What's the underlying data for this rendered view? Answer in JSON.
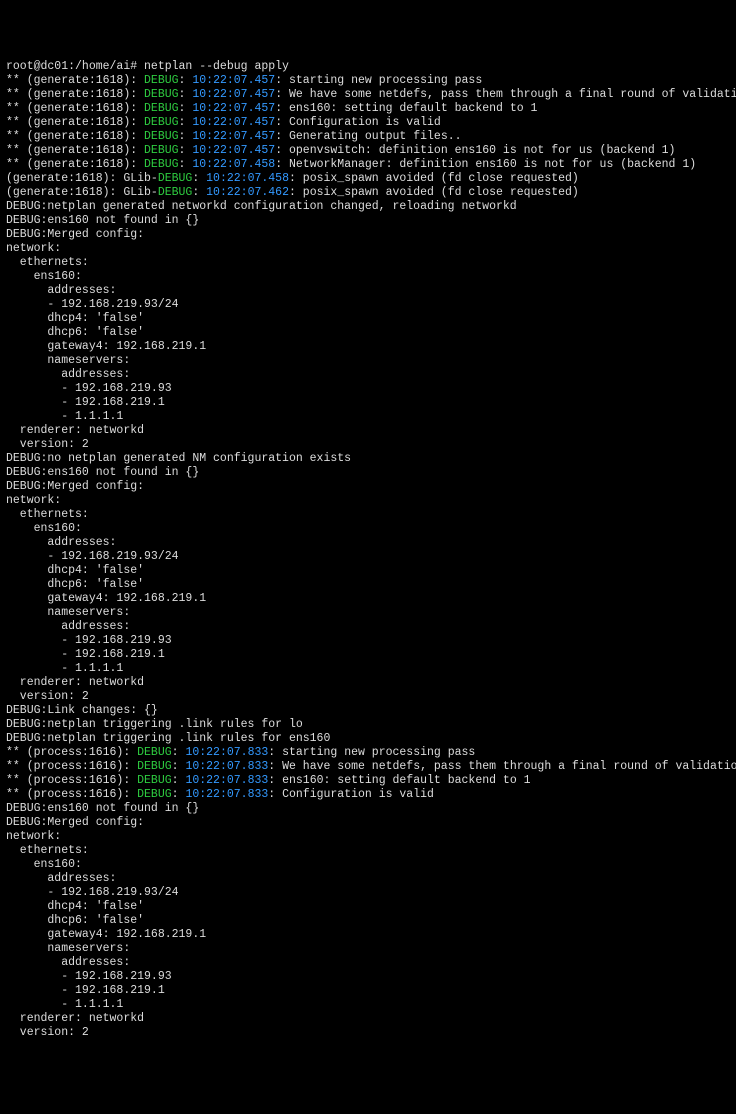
{
  "prompt": "root@dc01:/home/ai# netplan --debug apply",
  "lines": [
    {
      "segs": [
        {
          "t": "** (generate:1618): ",
          "c": "w"
        },
        {
          "t": "DEBUG",
          "c": "g"
        },
        {
          "t": ": ",
          "c": "w"
        },
        {
          "t": "10:22:07.457",
          "c": "b"
        },
        {
          "t": ": starting new processing pass",
          "c": "w"
        }
      ]
    },
    {
      "segs": [
        {
          "t": "** (generate:1618): ",
          "c": "w"
        },
        {
          "t": "DEBUG",
          "c": "g"
        },
        {
          "t": ": ",
          "c": "w"
        },
        {
          "t": "10:22:07.457",
          "c": "b"
        },
        {
          "t": ": We have some netdefs, pass them through a final round of validation",
          "c": "w"
        }
      ]
    },
    {
      "segs": [
        {
          "t": "** (generate:1618): ",
          "c": "w"
        },
        {
          "t": "DEBUG",
          "c": "g"
        },
        {
          "t": ": ",
          "c": "w"
        },
        {
          "t": "10:22:07.457",
          "c": "b"
        },
        {
          "t": ": ens160: setting default backend to 1",
          "c": "w"
        }
      ]
    },
    {
      "segs": [
        {
          "t": "** (generate:1618): ",
          "c": "w"
        },
        {
          "t": "DEBUG",
          "c": "g"
        },
        {
          "t": ": ",
          "c": "w"
        },
        {
          "t": "10:22:07.457",
          "c": "b"
        },
        {
          "t": ": Configuration is valid",
          "c": "w"
        }
      ]
    },
    {
      "segs": [
        {
          "t": "** (generate:1618): ",
          "c": "w"
        },
        {
          "t": "DEBUG",
          "c": "g"
        },
        {
          "t": ": ",
          "c": "w"
        },
        {
          "t": "10:22:07.457",
          "c": "b"
        },
        {
          "t": ": Generating output files..",
          "c": "w"
        }
      ]
    },
    {
      "segs": [
        {
          "t": "** (generate:1618): ",
          "c": "w"
        },
        {
          "t": "DEBUG",
          "c": "g"
        },
        {
          "t": ": ",
          "c": "w"
        },
        {
          "t": "10:22:07.457",
          "c": "b"
        },
        {
          "t": ": openvswitch: definition ens160 is not for us (backend 1)",
          "c": "w"
        }
      ]
    },
    {
      "segs": [
        {
          "t": "** (generate:1618): ",
          "c": "w"
        },
        {
          "t": "DEBUG",
          "c": "g"
        },
        {
          "t": ": ",
          "c": "w"
        },
        {
          "t": "10:22:07.458",
          "c": "b"
        },
        {
          "t": ": NetworkManager: definition ens160 is not for us (backend 1)",
          "c": "w"
        }
      ]
    },
    {
      "segs": [
        {
          "t": "(generate:1618): GLib-",
          "c": "w"
        },
        {
          "t": "DEBUG",
          "c": "g"
        },
        {
          "t": ": ",
          "c": "w"
        },
        {
          "t": "10:22:07.458",
          "c": "b"
        },
        {
          "t": ": posix_spawn avoided (fd close requested)",
          "c": "w"
        }
      ]
    },
    {
      "segs": [
        {
          "t": "(generate:1618): GLib-",
          "c": "w"
        },
        {
          "t": "DEBUG",
          "c": "g"
        },
        {
          "t": ": ",
          "c": "w"
        },
        {
          "t": "10:22:07.462",
          "c": "b"
        },
        {
          "t": ": posix_spawn avoided (fd close requested)",
          "c": "w"
        }
      ]
    },
    {
      "segs": [
        {
          "t": "DEBUG:netplan generated networkd configuration changed, reloading networkd",
          "c": "w"
        }
      ]
    },
    {
      "segs": [
        {
          "t": "DEBUG:ens160 not found in {}",
          "c": "w"
        }
      ]
    },
    {
      "segs": [
        {
          "t": "DEBUG:Merged config:",
          "c": "w"
        }
      ]
    },
    {
      "segs": [
        {
          "t": "network:",
          "c": "w"
        }
      ]
    },
    {
      "segs": [
        {
          "t": "  ethernets:",
          "c": "w"
        }
      ]
    },
    {
      "segs": [
        {
          "t": "    ens160:",
          "c": "w"
        }
      ]
    },
    {
      "segs": [
        {
          "t": "      addresses:",
          "c": "w"
        }
      ]
    },
    {
      "segs": [
        {
          "t": "      - 192.168.219.93/24",
          "c": "w"
        }
      ]
    },
    {
      "segs": [
        {
          "t": "      dhcp4: 'false'",
          "c": "w"
        }
      ]
    },
    {
      "segs": [
        {
          "t": "      dhcp6: 'false'",
          "c": "w"
        }
      ]
    },
    {
      "segs": [
        {
          "t": "      gateway4: 192.168.219.1",
          "c": "w"
        }
      ]
    },
    {
      "segs": [
        {
          "t": "      nameservers:",
          "c": "w"
        }
      ]
    },
    {
      "segs": [
        {
          "t": "        addresses:",
          "c": "w"
        }
      ]
    },
    {
      "segs": [
        {
          "t": "        - 192.168.219.93",
          "c": "w"
        }
      ]
    },
    {
      "segs": [
        {
          "t": "        - 192.168.219.1",
          "c": "w"
        }
      ]
    },
    {
      "segs": [
        {
          "t": "        - 1.1.1.1",
          "c": "w"
        }
      ]
    },
    {
      "segs": [
        {
          "t": "  renderer: networkd",
          "c": "w"
        }
      ]
    },
    {
      "segs": [
        {
          "t": "  version: 2",
          "c": "w"
        }
      ]
    },
    {
      "segs": [
        {
          "t": "",
          "c": "w"
        }
      ]
    },
    {
      "segs": [
        {
          "t": "DEBUG:no netplan generated NM configuration exists",
          "c": "w"
        }
      ]
    },
    {
      "segs": [
        {
          "t": "DEBUG:ens160 not found in {}",
          "c": "w"
        }
      ]
    },
    {
      "segs": [
        {
          "t": "DEBUG:Merged config:",
          "c": "w"
        }
      ]
    },
    {
      "segs": [
        {
          "t": "network:",
          "c": "w"
        }
      ]
    },
    {
      "segs": [
        {
          "t": "  ethernets:",
          "c": "w"
        }
      ]
    },
    {
      "segs": [
        {
          "t": "    ens160:",
          "c": "w"
        }
      ]
    },
    {
      "segs": [
        {
          "t": "      addresses:",
          "c": "w"
        }
      ]
    },
    {
      "segs": [
        {
          "t": "      - 192.168.219.93/24",
          "c": "w"
        }
      ]
    },
    {
      "segs": [
        {
          "t": "      dhcp4: 'false'",
          "c": "w"
        }
      ]
    },
    {
      "segs": [
        {
          "t": "      dhcp6: 'false'",
          "c": "w"
        }
      ]
    },
    {
      "segs": [
        {
          "t": "      gateway4: 192.168.219.1",
          "c": "w"
        }
      ]
    },
    {
      "segs": [
        {
          "t": "      nameservers:",
          "c": "w"
        }
      ]
    },
    {
      "segs": [
        {
          "t": "        addresses:",
          "c": "w"
        }
      ]
    },
    {
      "segs": [
        {
          "t": "        - 192.168.219.93",
          "c": "w"
        }
      ]
    },
    {
      "segs": [
        {
          "t": "        - 192.168.219.1",
          "c": "w"
        }
      ]
    },
    {
      "segs": [
        {
          "t": "        - 1.1.1.1",
          "c": "w"
        }
      ]
    },
    {
      "segs": [
        {
          "t": "  renderer: networkd",
          "c": "w"
        }
      ]
    },
    {
      "segs": [
        {
          "t": "  version: 2",
          "c": "w"
        }
      ]
    },
    {
      "segs": [
        {
          "t": "",
          "c": "w"
        }
      ]
    },
    {
      "segs": [
        {
          "t": "DEBUG:Link changes: {}",
          "c": "w"
        }
      ]
    },
    {
      "segs": [
        {
          "t": "DEBUG:netplan triggering .link rules for lo",
          "c": "w"
        }
      ]
    },
    {
      "segs": [
        {
          "t": "DEBUG:netplan triggering .link rules for ens160",
          "c": "w"
        }
      ]
    },
    {
      "segs": [
        {
          "t": "** (process:1616): ",
          "c": "w"
        },
        {
          "t": "DEBUG",
          "c": "g"
        },
        {
          "t": ": ",
          "c": "w"
        },
        {
          "t": "10:22:07.833",
          "c": "b"
        },
        {
          "t": ": starting new processing pass",
          "c": "w"
        }
      ]
    },
    {
      "segs": [
        {
          "t": "** (process:1616): ",
          "c": "w"
        },
        {
          "t": "DEBUG",
          "c": "g"
        },
        {
          "t": ": ",
          "c": "w"
        },
        {
          "t": "10:22:07.833",
          "c": "b"
        },
        {
          "t": ": We have some netdefs, pass them through a final round of validation",
          "c": "w"
        }
      ]
    },
    {
      "segs": [
        {
          "t": "** (process:1616): ",
          "c": "w"
        },
        {
          "t": "DEBUG",
          "c": "g"
        },
        {
          "t": ": ",
          "c": "w"
        },
        {
          "t": "10:22:07.833",
          "c": "b"
        },
        {
          "t": ": ens160: setting default backend to 1",
          "c": "w"
        }
      ]
    },
    {
      "segs": [
        {
          "t": "** (process:1616): ",
          "c": "w"
        },
        {
          "t": "DEBUG",
          "c": "g"
        },
        {
          "t": ": ",
          "c": "w"
        },
        {
          "t": "10:22:07.833",
          "c": "b"
        },
        {
          "t": ": Configuration is valid",
          "c": "w"
        }
      ]
    },
    {
      "segs": [
        {
          "t": "DEBUG:ens160 not found in {}",
          "c": "w"
        }
      ]
    },
    {
      "segs": [
        {
          "t": "DEBUG:Merged config:",
          "c": "w"
        }
      ]
    },
    {
      "segs": [
        {
          "t": "network:",
          "c": "w"
        }
      ]
    },
    {
      "segs": [
        {
          "t": "  ethernets:",
          "c": "w"
        }
      ]
    },
    {
      "segs": [
        {
          "t": "    ens160:",
          "c": "w"
        }
      ]
    },
    {
      "segs": [
        {
          "t": "      addresses:",
          "c": "w"
        }
      ]
    },
    {
      "segs": [
        {
          "t": "      - 192.168.219.93/24",
          "c": "w"
        }
      ]
    },
    {
      "segs": [
        {
          "t": "      dhcp4: 'false'",
          "c": "w"
        }
      ]
    },
    {
      "segs": [
        {
          "t": "      dhcp6: 'false'",
          "c": "w"
        }
      ]
    },
    {
      "segs": [
        {
          "t": "      gateway4: 192.168.219.1",
          "c": "w"
        }
      ]
    },
    {
      "segs": [
        {
          "t": "      nameservers:",
          "c": "w"
        }
      ]
    },
    {
      "segs": [
        {
          "t": "        addresses:",
          "c": "w"
        }
      ]
    },
    {
      "segs": [
        {
          "t": "        - 192.168.219.93",
          "c": "w"
        }
      ]
    },
    {
      "segs": [
        {
          "t": "        - 192.168.219.1",
          "c": "w"
        }
      ]
    },
    {
      "segs": [
        {
          "t": "        - 1.1.1.1",
          "c": "w"
        }
      ]
    },
    {
      "segs": [
        {
          "t": "  renderer: networkd",
          "c": "w"
        }
      ]
    },
    {
      "segs": [
        {
          "t": "  version: 2",
          "c": "w"
        }
      ]
    }
  ]
}
